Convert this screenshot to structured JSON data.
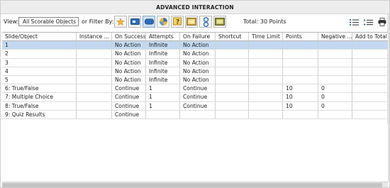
{
  "window": {
    "title": "ADVANCED INTERACTION"
  },
  "toolbar": {
    "view_label": "View:",
    "view_value": "All Scorable Objects",
    "filter_label": "or Filter By:",
    "filters": [
      {
        "name": "filter-star-icon",
        "active": false
      },
      {
        "name": "filter-button-icon",
        "active": false
      },
      {
        "name": "filter-shape-button-icon",
        "active": true
      },
      {
        "name": "filter-rollover-icon",
        "active": false
      },
      {
        "name": "filter-question-icon",
        "active": false
      },
      {
        "name": "filter-slide-icon",
        "active": false
      },
      {
        "name": "filter-link-icon",
        "active": false
      },
      {
        "name": "filter-frame-icon",
        "active": false
      }
    ],
    "total": "Total: 30 Points"
  },
  "columns": [
    "Slide/Object",
    "Instance ...",
    "On Success",
    "Attempts",
    "On Failure",
    "Shortcut",
    "Time Limit",
    "Points",
    "Negative ...",
    "Add to Total"
  ],
  "rows": [
    [
      "1",
      "",
      "No Action",
      "Infinite",
      "No Action",
      "",
      "",
      "",
      "",
      ""
    ],
    [
      "2",
      "",
      "No Action",
      "Infinite",
      "No Action",
      "",
      "",
      "",
      "",
      ""
    ],
    [
      "3",
      "",
      "No Action",
      "Infinite",
      "No Action",
      "",
      "",
      "",
      "",
      ""
    ],
    [
      "4",
      "",
      "No Action",
      "Infinite",
      "No Action",
      "",
      "",
      "",
      "",
      ""
    ],
    [
      "5",
      "",
      "No Action",
      "Infinite",
      "No Action",
      "",
      "",
      "",
      "",
      ""
    ],
    [
      "6: True/False",
      "",
      "Continue",
      "1",
      "Continue",
      "",
      "",
      "10",
      "0",
      ""
    ],
    [
      "7: Multiple Choice",
      "",
      "Continue",
      "1",
      "Continue",
      "",
      "",
      "10",
      "0",
      ""
    ],
    [
      "8: True/False",
      "",
      "Continue",
      "1",
      "Continue",
      "",
      "",
      "10",
      "0",
      ""
    ],
    [
      "9: Quiz Results",
      "",
      "Continue",
      "",
      "",
      "",
      "",
      "",
      "",
      ""
    ]
  ],
  "selected_row": 0,
  "colors": {
    "selection": "#c3d8f0",
    "accent": "#2f6fb6"
  }
}
